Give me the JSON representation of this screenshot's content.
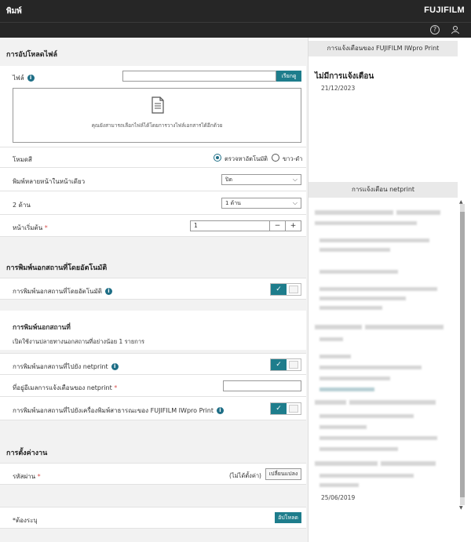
{
  "header": {
    "title": "พิมพ์",
    "brand": "FUJIFILM"
  },
  "upload": {
    "section_title": "การอัปโหลดไฟล์",
    "file_label": "ไฟล์",
    "file_value": "",
    "browse_label": "เรียกดู",
    "drop_hint": "คุณยังสามารถเลือกไฟล์ได้โดยการวางไฟล์เอกสารได้อีกด้วย",
    "mode_label": "โหมดสี",
    "mode_auto": "ตรวจหาอัตโนมัติ",
    "mode_bw": "ขาว-ดำ",
    "nup_label": "พิมพ์หลายหน้าในหน้าเดียว",
    "nup_value": "ปิด",
    "duplex_label": "2 ด้าน",
    "duplex_value": "1 ด้าน",
    "start_page_label": "หน้าเริ่มต้น",
    "start_page_value": "1"
  },
  "auto_print": {
    "section_title": "การพิมพ์นอกสถานที่โดยอัตโนมัติ",
    "toggle_label": "การพิมพ์นอกสถานที่โดยอัตโนมัติ",
    "toggle_on": true
  },
  "offsite": {
    "section_title": "การพิมพ์นอกสถานที่",
    "note": "เปิดใช้งานปลายทางนอกสถานที่อย่างน้อย 1 รายการ",
    "netprint_label": "การพิมพ์นอกสถานที่ไปยัง netprint",
    "netprint_on": true,
    "email_label": "ที่อยู่อีเมลการแจ้งเตือนของ netprint",
    "email_value": "",
    "iwpro_label": "การพิมพ์นอกสถานที่ไปยังเครื่องพิมพ์สาธารณะของ FUJIFILM IWpro Print",
    "iwpro_on": true
  },
  "job": {
    "section_title": "การตั้งค่างาน",
    "passcode_label": "รหัสผ่าน",
    "passcode_status": "(ไม่ได้ตั้งค่า)",
    "change_label": "เปลี่ยนแปลง"
  },
  "footer": {
    "required_note": "*ต้องระบุ",
    "upload_label": "อัปโหลด"
  },
  "notifications": {
    "iwpro_title": "การแจ้งเตือนของ FUJIFILM IWpro Print",
    "none_label": "ไม่มีการแจ้งเตือน",
    "none_date": "21/12/2023",
    "netprint_title": "การแจ้งเตือน netprint",
    "last_date": "25/06/2019"
  },
  "colors": {
    "accent": "#1e7d8c",
    "header": "#262626"
  }
}
